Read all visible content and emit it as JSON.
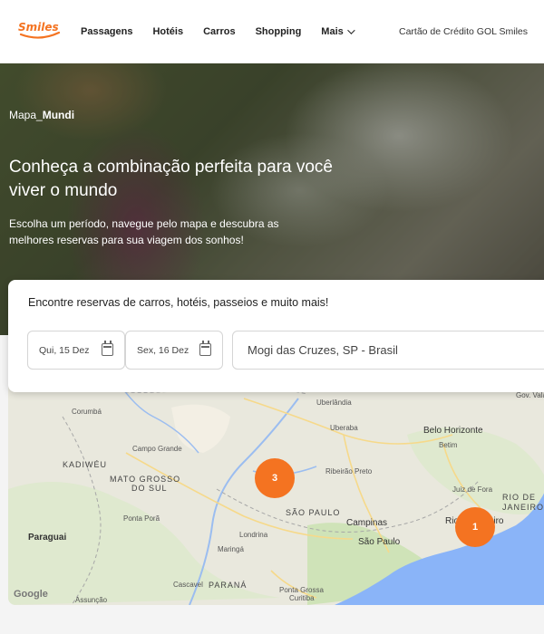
{
  "header": {
    "logo_text": "Smiles",
    "nav": [
      {
        "label": "Passagens"
      },
      {
        "label": "Hotéis"
      },
      {
        "label": "Carros"
      },
      {
        "label": "Shopping"
      },
      {
        "label": "Mais"
      }
    ],
    "right_link": "Cartão de Crédito GOL Smiles",
    "right_cut": "C"
  },
  "hero": {
    "brand_prefix": "Mapa_",
    "brand_bold": "Mundi",
    "title": "Conheça a combinação perfeita para você viver o mundo",
    "subtitle": "Escolha um período, navegue pelo mapa e descubra as melhores reservas para sua viagem dos sonhos!"
  },
  "search": {
    "title": "Encontre reservas de carros, hotéis, passeios e muito mais!",
    "checkin": "Qui, 15 Dez",
    "checkout": "Sex, 16 Dez",
    "location": "Mogi das Cruzes, SP - Brasil"
  },
  "map": {
    "labels": {
      "corumba": "Corumbá",
      "uberlandia": "Uberlândia",
      "gov_valadares": "Gov. Valadares",
      "uberaba": "Uberaba",
      "campo_grande": "Campo Grande",
      "belo_horizonte": "Belo Horizonte",
      "betim": "Betim",
      "kadiweu": "KADIWÉU",
      "mato_grosso": "MATO GROSSO",
      "do_sul": "DO SUL",
      "ribeirao": "Ribeirão Preto",
      "juiz_de_fora": "Juiz de Fora",
      "rio_de": "RIO DE",
      "janeiro": "JANEIRO",
      "ponta_pora": "Ponta Porã",
      "sao_paulo_state": "SÃO PAULO",
      "campinas": "Campinas",
      "rio_city": "Rio de Janeiro",
      "paraguai": "Paraguai",
      "londrina": "Londrina",
      "sao_paulo": "São Paulo",
      "maringa": "Maringá",
      "cascavel": "Cascavel",
      "parana": "PARANÁ",
      "ponta_grossa": "Ponta Grossa",
      "curitiba": "Curitiba",
      "assuncao": "Assunção",
      "google": "Google"
    },
    "clusters": [
      {
        "count": "3"
      },
      {
        "count": "1"
      }
    ]
  },
  "colors": {
    "brand_orange": "#f47321",
    "sea": "#8ab4f8",
    "land": "#e9e8dd",
    "green": "#cfe3b8"
  }
}
